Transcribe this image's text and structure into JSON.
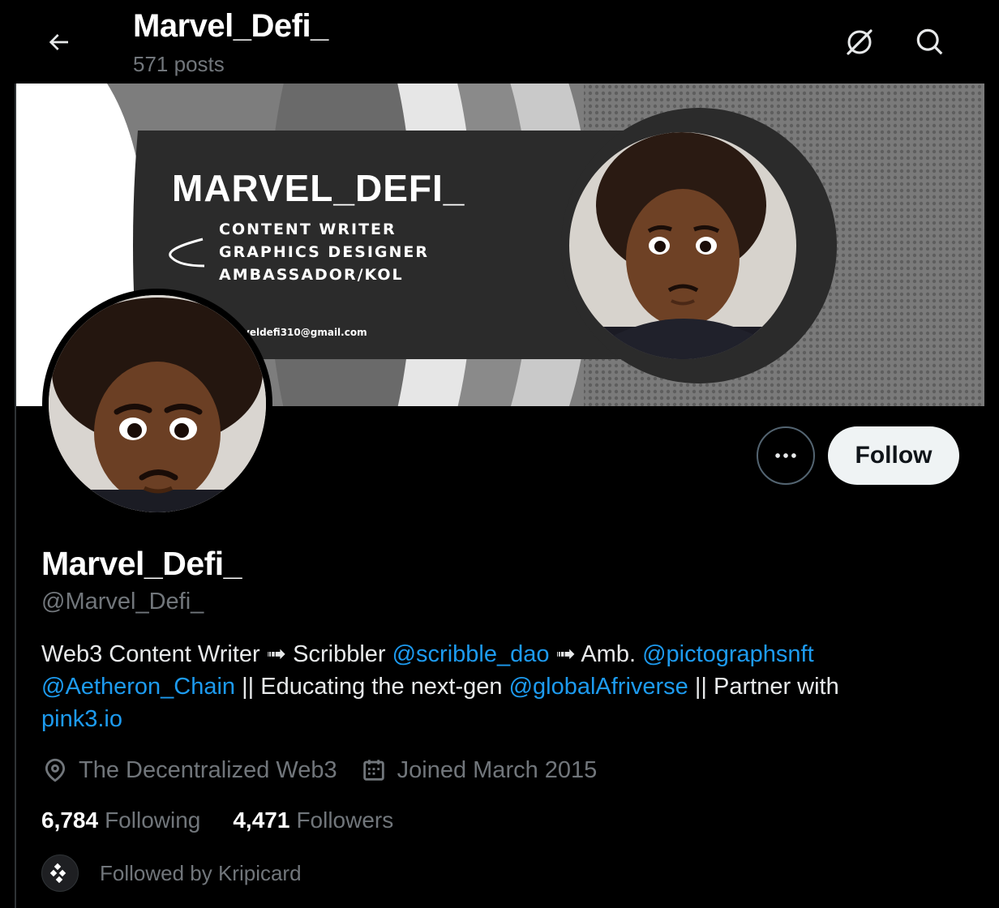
{
  "header": {
    "title": "Marvel_Defi_",
    "posts_count": "571 posts",
    "back_icon": "arrow-left-icon",
    "grok_icon": "grok-icon",
    "search_icon": "search-icon"
  },
  "banner": {
    "headline": "MARVEL_DEFI_",
    "roles": [
      "CONTENT WRITER",
      "GRAPHICS DESIGNER",
      "AMBASSADOR/KOL"
    ],
    "email": "veldefi310@gmail.com"
  },
  "actions": {
    "more_icon": "more-horizontal-icon",
    "follow_label": "Follow"
  },
  "profile": {
    "display_name": "Marvel_Defi_",
    "handle": "@Marvel_Defi_",
    "bio": {
      "t1": "Web3 Content Writer ➟ Scribbler ",
      "l1": "@scribble_dao",
      "t2": " ➟ Amb. ",
      "l2": "@pictographsnft",
      "t3": " ",
      "l3": "@Aetheron_Chain",
      "t4": " || Educating the next-gen ",
      "l4": "@globalAfriverse",
      "t5": " || Partner with ",
      "l5": "pink3.io"
    },
    "location": "The Decentralized Web3",
    "joined": "Joined March 2015",
    "following_count": "6,784",
    "following_label": "Following",
    "followers_count": "4,471",
    "followers_label": "Followers",
    "followed_by": "Followed by Kripicard"
  },
  "colors": {
    "accent": "#1d9bf0",
    "muted": "#71767b",
    "background": "#000000",
    "follow_button": "#eff3f4"
  }
}
